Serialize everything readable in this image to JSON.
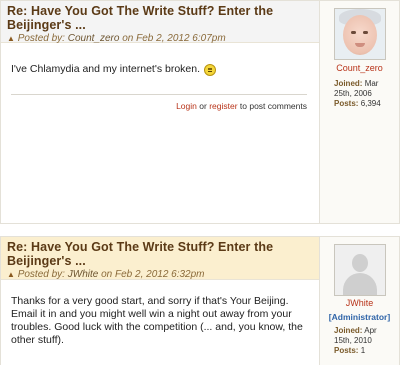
{
  "posts": [
    {
      "title": "Re: Have You Got The Write Stuff? Enter the Beijinger's ...",
      "posted_by_label": "Posted by:",
      "author": "Count_zero",
      "on_label": "on",
      "date": "Feb 2, 2012 6:07pm",
      "body": "I've Chlamydia and my internet's broken.",
      "emoticon": "smiley-icon",
      "login_label": "Login",
      "or_label": "or",
      "register_label": "register",
      "post_comments_label": "to post comments",
      "sidebar": {
        "username": "Count_zero",
        "joined_label": "Joined:",
        "joined_value": "Mar 25th, 2006",
        "posts_label": "Posts:",
        "posts_value": "6,394"
      }
    },
    {
      "title": "Re: Have You Got The Write Stuff? Enter the Beijinger's ...",
      "posted_by_label": "Posted by:",
      "author": "JWhite",
      "on_label": "on",
      "date": "Feb 2, 2012 6:32pm",
      "body": "Thanks for a very good start, and sorry if that's Your Beijing. Email it in and you might well win a night out away from your troubles. Good luck with the competition (... and, you know, the other stuff).",
      "sidebar": {
        "username": "JWhite",
        "role": "[Administrator]",
        "joined_label": "Joined:",
        "joined_value": "Apr 15th, 2010",
        "posts_label": "Posts:",
        "posts_value": "1"
      }
    }
  ],
  "colors": {
    "title": "#5b3a16",
    "link": "#b8341a",
    "admin": "#2f64a8",
    "header_highlight": "#fbefcf"
  }
}
